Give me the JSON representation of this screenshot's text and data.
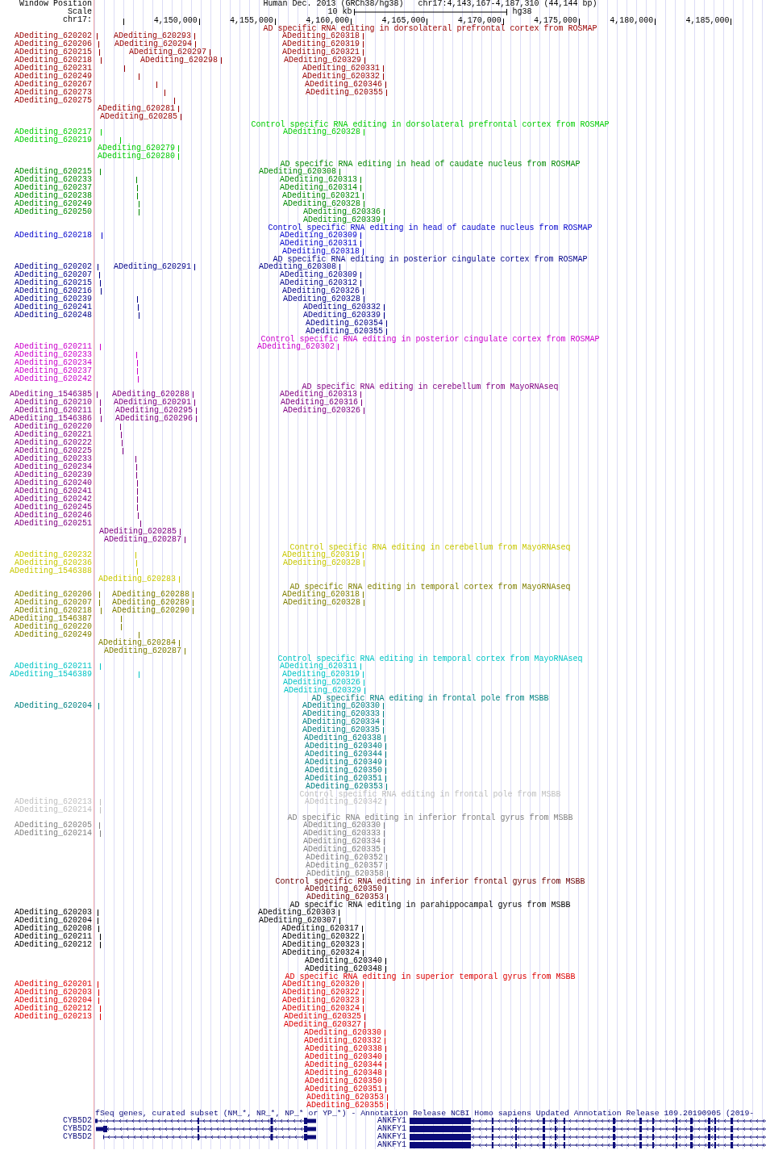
{
  "position": {
    "label": "Window Position",
    "assembly": "Human Dec. 2013 (GRCh38/hg38)",
    "region": "chr17:4,143,167-4,187,310 (44,144 bp)"
  },
  "scale": {
    "label": "Scale",
    "length": "10 kb",
    "assembly": "hg38"
  },
  "ruler": {
    "label": "chr17:",
    "ticks": [
      "4,150,000",
      "4,155,000",
      "4,160,000",
      "4,165,000",
      "4,170,000",
      "4,175,000",
      "4,180,000",
      "4,185,000"
    ]
  },
  "tracks": [
    {
      "title": "AD specific RNA editing in dorsolateral prefrontal cortex from ROSMAP",
      "color": "#990000",
      "rows": [
        [
          "ADediting_620202",
          "ADediting_620293",
          "ADediting_620318"
        ],
        [
          "ADediting_620206",
          "ADediting_620294",
          "ADediting_620319"
        ],
        [
          "ADediting_620215",
          "ADediting_620297",
          "ADediting_620321"
        ],
        [
          "ADediting_620218",
          "ADediting_620298",
          "ADediting_620329"
        ],
        [
          "ADediting_620231",
          "",
          "ADediting_620331"
        ],
        [
          "ADediting_620249",
          "",
          "ADediting_620332"
        ],
        [
          "ADediting_620267",
          "",
          "ADediting_620346"
        ],
        [
          "ADediting_620273",
          "",
          "ADediting_620355"
        ],
        [
          "ADediting_620275"
        ],
        [
          "",
          "ADediting_620281"
        ],
        [
          "",
          "ADediting_620285"
        ]
      ]
    },
    {
      "title": "Control specific RNA editing in dorsolateral prefrontal cortex from ROSMAP",
      "color": "#00cc00",
      "rows": [
        [
          "ADediting_620217",
          "ADediting_620328"
        ],
        [
          "ADediting_620219"
        ],
        [
          "",
          "ADediting_620279"
        ],
        [
          "",
          "ADediting_620280"
        ]
      ]
    },
    {
      "title": "AD specific RNA editing in head of caudate nucleus from ROSMAP",
      "color": "#008800",
      "rows": [
        [
          "ADediting_620215",
          "ADediting_620308"
        ],
        [
          "ADediting_620233",
          "ADediting_620313"
        ],
        [
          "ADediting_620237",
          "ADediting_620314"
        ],
        [
          "ADediting_620238",
          "ADediting_620321"
        ],
        [
          "ADediting_620249",
          "ADediting_620328"
        ],
        [
          "ADediting_620250",
          "ADediting_620336"
        ],
        [
          "",
          "ADediting_620339"
        ]
      ]
    },
    {
      "title": "Control specific RNA editing in head of caudate nucleus from ROSMAP",
      "color": "#0000cc",
      "rows": [
        [
          "ADediting_620218",
          "ADediting_620309"
        ],
        [
          "",
          "ADediting_620311"
        ],
        [
          "",
          "ADediting_620318"
        ]
      ]
    },
    {
      "title": "AD specific RNA editing in posterior cingulate cortex from ROSMAP",
      "color": "#000088",
      "rows": [
        [
          "ADediting_620202",
          "ADediting_620291",
          "ADediting_620308"
        ],
        [
          "ADediting_620207",
          "",
          "ADediting_620309"
        ],
        [
          "ADediting_620215",
          "",
          "ADediting_620312"
        ],
        [
          "ADediting_620216",
          "",
          "ADediting_620326"
        ],
        [
          "ADediting_620239",
          "",
          "ADediting_620328"
        ],
        [
          "ADediting_620241",
          "",
          "ADediting_620332"
        ],
        [
          "ADediting_620248",
          "",
          "ADediting_620339"
        ],
        [
          "",
          "",
          "ADediting_620354"
        ],
        [
          "",
          "",
          "ADediting_620355"
        ]
      ]
    },
    {
      "title": "Control specific RNA editing in posterior cingulate cortex from ROSMAP",
      "color": "#cc00cc",
      "rows": [
        [
          "ADediting_620211",
          "ADediting_620302"
        ],
        [
          "ADediting_620233"
        ],
        [
          "ADediting_620234"
        ],
        [
          "ADediting_620237"
        ],
        [
          "ADediting_620242"
        ]
      ]
    },
    {
      "title": "AD specific RNA editing in cerebellum from MayoRNAseq",
      "color": "#800080",
      "rows": [
        [
          "ADediting_1546385",
          "ADediting_620288",
          "ADediting_620313"
        ],
        [
          "ADediting_620210",
          "ADediting_620291",
          "ADediting_620316"
        ],
        [
          "ADediting_620211",
          "ADediting_620295",
          "ADediting_620326"
        ],
        [
          "ADediting_1546386",
          "ADediting_620296"
        ],
        [
          "ADediting_620220"
        ],
        [
          "ADediting_620221"
        ],
        [
          "ADediting_620222"
        ],
        [
          "ADediting_620225"
        ],
        [
          "ADediting_620233"
        ],
        [
          "ADediting_620234"
        ],
        [
          "ADediting_620239"
        ],
        [
          "ADediting_620240"
        ],
        [
          "ADediting_620241"
        ],
        [
          "ADediting_620242"
        ],
        [
          "ADediting_620245"
        ],
        [
          "ADediting_620246"
        ],
        [
          "ADediting_620251"
        ],
        [
          "",
          "ADediting_620285"
        ],
        [
          "",
          "ADediting_620287"
        ]
      ]
    },
    {
      "title": "Control specific RNA editing in cerebellum from MayoRNAseq",
      "color": "#c8c800",
      "rows": [
        [
          "ADediting_620232",
          "ADediting_620319"
        ],
        [
          "ADediting_620236",
          "ADediting_620328"
        ],
        [
          "ADediting_1546388"
        ],
        [
          "",
          "ADediting_620283"
        ]
      ]
    },
    {
      "title": "AD specific RNA editing in temporal cortex from MayoRNAseq",
      "color": "#808000",
      "rows": [
        [
          "ADediting_620206",
          "ADediting_620288",
          "ADediting_620318"
        ],
        [
          "ADediting_620207",
          "ADediting_620289",
          "ADediting_620328"
        ],
        [
          "ADediting_620218",
          "ADediting_620290"
        ],
        [
          "ADediting_1546387"
        ],
        [
          "ADediting_620220"
        ],
        [
          "ADediting_620249"
        ],
        [
          "",
          "ADediting_620284"
        ],
        [
          "",
          "ADediting_620287"
        ]
      ]
    },
    {
      "title": "Control specific RNA editing in temporal cortex from MayoRNAseq",
      "color": "#00c4c4",
      "rows": [
        [
          "ADediting_620211",
          "ADediting_620311"
        ],
        [
          "ADediting_1546389",
          "ADediting_620319"
        ],
        [
          "",
          "ADediting_620326"
        ],
        [
          "",
          "ADediting_620329"
        ]
      ]
    },
    {
      "title": "AD specific RNA editing in frontal pole from MSBB",
      "color": "#008080",
      "rows": [
        [
          "ADediting_620204",
          "ADediting_620330"
        ],
        [
          "",
          "ADediting_620333"
        ],
        [
          "",
          "ADediting_620334"
        ],
        [
          "",
          "ADediting_620335"
        ],
        [
          "",
          "ADediting_620338"
        ],
        [
          "",
          "ADediting_620340"
        ],
        [
          "",
          "ADediting_620344"
        ],
        [
          "",
          "ADediting_620349"
        ],
        [
          "",
          "ADediting_620350"
        ],
        [
          "",
          "ADediting_620351"
        ],
        [
          "",
          "ADediting_620353"
        ]
      ]
    },
    {
      "title": "Control specific RNA editing in frontal pole from MSBB",
      "color": "#c0c0c0",
      "rows": [
        [
          "ADediting_620213",
          "ADediting_620342"
        ],
        [
          "ADediting_620214"
        ]
      ]
    },
    {
      "title": "AD specific RNA editing in inferior frontal gyrus from MSBB",
      "color": "#808080",
      "rows": [
        [
          "ADediting_620205",
          "ADediting_620330"
        ],
        [
          "ADediting_620214",
          "ADediting_620333"
        ],
        [
          "",
          "ADediting_620334"
        ],
        [
          "",
          "ADediting_620335"
        ],
        [
          "",
          "ADediting_620352"
        ],
        [
          "",
          "ADediting_620357"
        ],
        [
          "",
          "ADediting_620358"
        ]
      ]
    },
    {
      "title": "Control specific RNA editing in inferior frontal gyrus from MSBB",
      "color": "#6b0000",
      "rows": [
        [
          "ADediting_620350"
        ],
        [
          "ADediting_620353"
        ]
      ]
    },
    {
      "title": "AD specific RNA editing in parahippocampal gyrus from MSBB",
      "color": "#000000",
      "rows": [
        [
          "ADediting_620203",
          "ADediting_620303"
        ],
        [
          "ADediting_620204",
          "ADediting_620307"
        ],
        [
          "ADediting_620208",
          "ADediting_620317"
        ],
        [
          "ADediting_620211",
          "ADediting_620322"
        ],
        [
          "ADediting_620212",
          "ADediting_620323"
        ],
        [
          "",
          "ADediting_620324"
        ],
        [
          "",
          "ADediting_620340"
        ],
        [
          "",
          "ADediting_620348"
        ]
      ]
    },
    {
      "title": "AD specific RNA editing in superior temporal gyrus from MSBB",
      "color": "#dd0000",
      "rows": [
        [
          "ADediting_620201",
          "ADediting_620320"
        ],
        [
          "ADediting_620203",
          "ADediting_620322"
        ],
        [
          "ADediting_620204",
          "ADediting_620323"
        ],
        [
          "ADediting_620212",
          "ADediting_620324"
        ],
        [
          "ADediting_620213",
          "ADediting_620325"
        ],
        [
          "",
          "ADediting_620327"
        ],
        [
          "",
          "ADediting_620330"
        ],
        [
          "",
          "ADediting_620332"
        ],
        [
          "",
          "ADediting_620338"
        ],
        [
          "",
          "ADediting_620340"
        ],
        [
          "",
          "ADediting_620344"
        ],
        [
          "",
          "ADediting_620348"
        ],
        [
          "",
          "ADediting_620350"
        ],
        [
          "",
          "ADediting_620351"
        ],
        [
          "",
          "ADediting_620353"
        ],
        [
          "",
          "ADediting_620355"
        ]
      ]
    }
  ],
  "gene_track": {
    "title": "fSeq genes, curated subset (NM_*, NR_*, NP_* or YP_*) - Annotation Release NCBI Homo sapiens Updated Annotation Release 109.20190905 (2019-",
    "rows": [
      [
        "CYB5D2",
        "ANKFY1"
      ],
      [
        "CYB5D2",
        "ANKFY1"
      ],
      [
        "CYB5D2",
        "ANKFY1"
      ],
      [
        "",
        "ANKFY1"
      ]
    ]
  }
}
